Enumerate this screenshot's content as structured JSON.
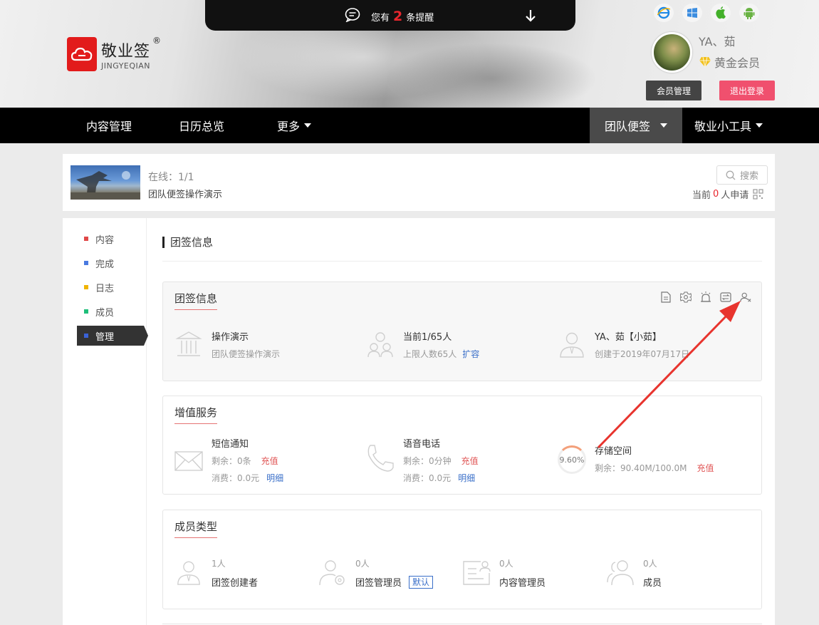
{
  "notice": {
    "prefix": "您有",
    "count": "2",
    "suffix": "条提醒"
  },
  "logo": {
    "name": "敬业签",
    "sub": "JINGYEQIAN",
    "reg": "®"
  },
  "user": {
    "name": "YA、茹",
    "level": "黄金会员",
    "member_btn": "会员管理",
    "logout_btn": "退出登录"
  },
  "nav": {
    "items": [
      "内容管理",
      "日历总览",
      "更多",
      "团队便签",
      "敬业小工具"
    ]
  },
  "team": {
    "online": "在线：1/1",
    "name": "团队便签操作演示",
    "search": "搜索",
    "apply_prefix": "当前",
    "apply_count": "0",
    "apply_suffix": "人申请"
  },
  "sidebar": {
    "items": [
      {
        "label": "内容",
        "color": "#e04848"
      },
      {
        "label": "完成",
        "color": "#4a7ae0"
      },
      {
        "label": "日志",
        "color": "#f0b400"
      },
      {
        "label": "成员",
        "color": "#1fbf7a"
      },
      {
        "label": "管理",
        "color": "#3a62d6"
      }
    ]
  },
  "page_title": "团签信息",
  "info_card": {
    "title": "团签信息",
    "team": {
      "name": "操作演示",
      "desc": "团队便签操作演示"
    },
    "members": {
      "current": "当前1/65人",
      "limit": "上限人数65人",
      "expand": "扩容"
    },
    "creator": {
      "name": "YA、茹【小茹】",
      "created": "创建于2019年07月17日"
    }
  },
  "service_card": {
    "title": "增值服务",
    "sms": {
      "name": "短信通知",
      "remain": "剩余：0条",
      "recharge": "充值",
      "spent": "消费：0.0元",
      "detail": "明细"
    },
    "voice": {
      "name": "语音电话",
      "remain": "剩余：0分钟",
      "recharge": "充值",
      "spent": "消费：0.0元",
      "detail": "明细"
    },
    "storage": {
      "percent": "9.60%",
      "name": "存储空间",
      "remain": "剩余：90.40M/100.0M",
      "recharge": "充值"
    }
  },
  "member_card": {
    "title": "成员类型",
    "types": [
      {
        "count": "1人",
        "name": "团签创建者"
      },
      {
        "count": "0人",
        "name": "团签管理员",
        "tag": "默认"
      },
      {
        "count": "0人",
        "name": "内容管理员"
      },
      {
        "count": "0人",
        "name": "成员"
      }
    ]
  },
  "colors": {
    "nav_bg": "#000000",
    "active_nav": "#4a4a4a",
    "logout": "#f0506e",
    "accent_red": "#e8262d",
    "link_blue": "#3a6fc9"
  }
}
